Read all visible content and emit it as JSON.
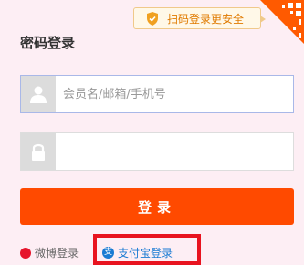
{
  "qr_tip": {
    "text": "扫码登录更安全",
    "icon": "shield-icon"
  },
  "qr_corner": {
    "icon": "qr-code-icon"
  },
  "title": "密码登录",
  "username": {
    "placeholder": "会员名/邮箱/手机号",
    "value": "",
    "icon": "user-icon"
  },
  "password": {
    "placeholder": "",
    "value": "",
    "icon": "lock-icon"
  },
  "login_button": "登录",
  "links": {
    "weibo": "微博登录",
    "alipay": "支付宝登录"
  },
  "colors": {
    "background": "#fdeef4",
    "accent": "#ff4a00",
    "tip_text": "#e07a00",
    "highlight": "#e8131f",
    "alipay": "#1a7bd3"
  }
}
